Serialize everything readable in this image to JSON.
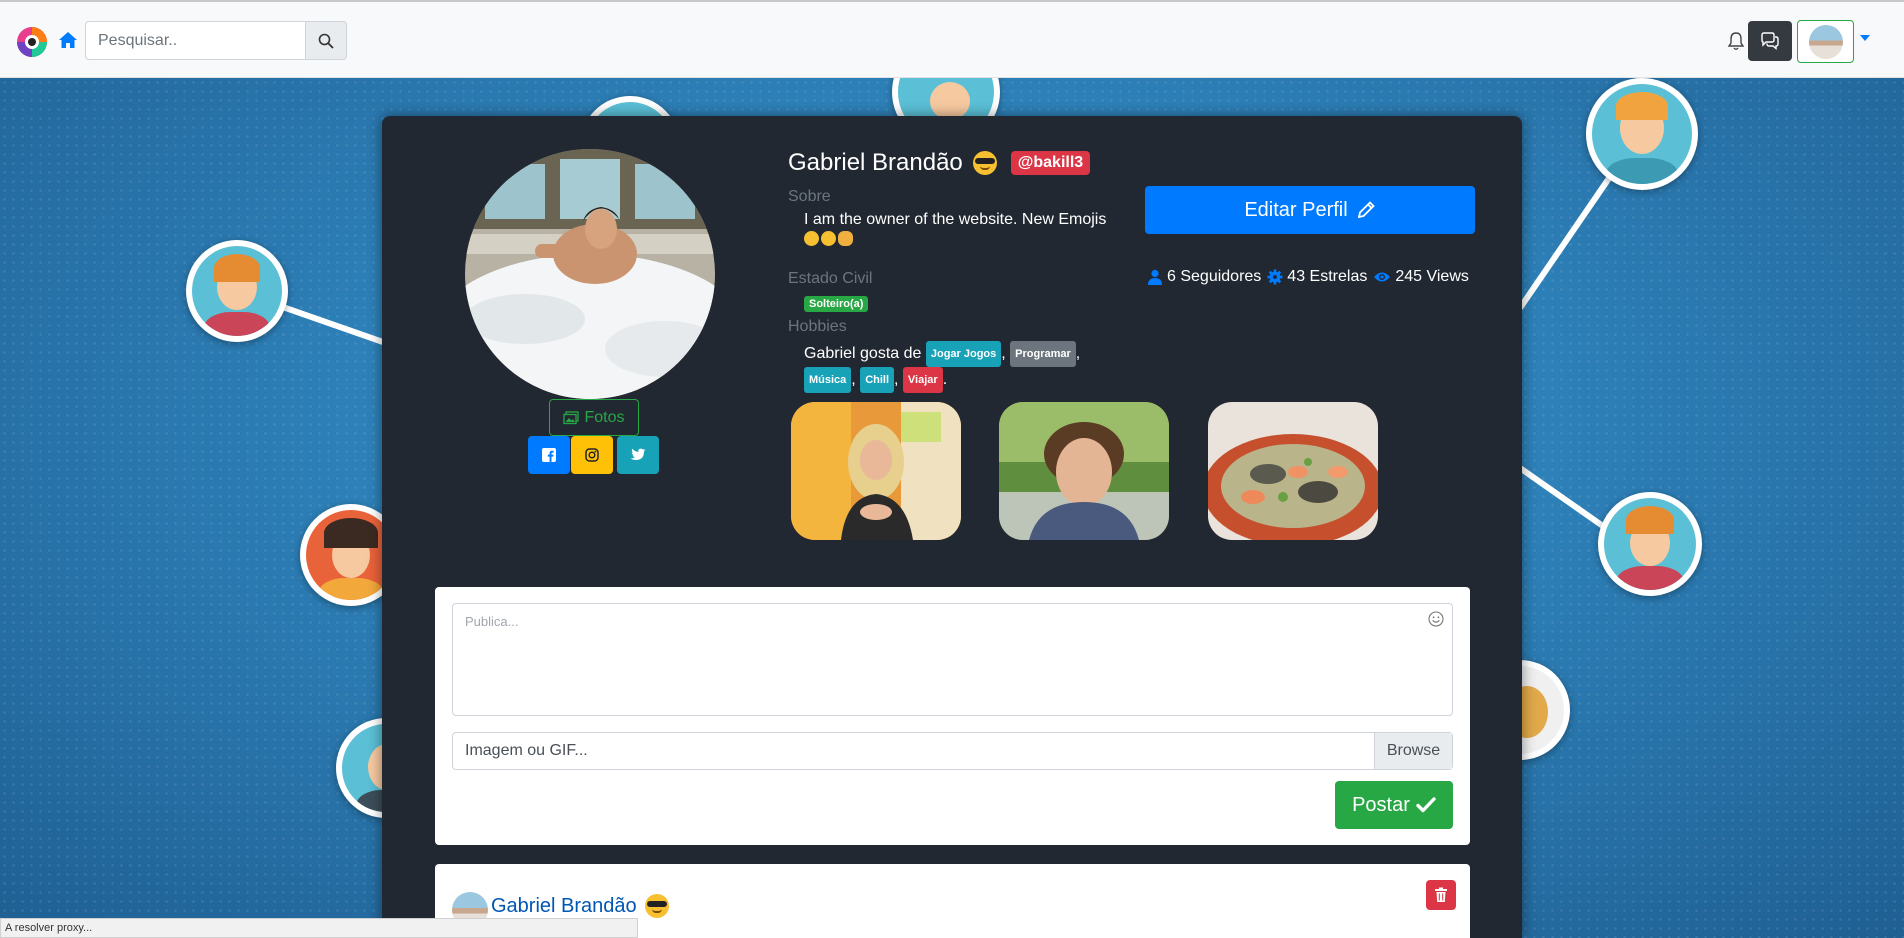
{
  "navbar": {
    "search_placeholder": "Pesquisar.."
  },
  "profile": {
    "name": "Gabriel Brandão",
    "handle": "@bakill3",
    "about_label": "Sobre",
    "about_text": "I am the owner of the website. New Emojis",
    "estado_label": "Estado Civil",
    "estado_value": "Solteiro(a)",
    "hobbies_label": "Hobbies",
    "hobbies_prefix": "Gabriel gosta de",
    "hobbies": [
      "Jogar Jogos",
      "Programar",
      "Música",
      "Chill",
      "Viajar"
    ],
    "fotos_label": "Fotos",
    "edit_label": "Editar Perfil",
    "stats": {
      "followers": "6 Seguidores",
      "stars": "43 Estrelas",
      "views": "245 Views"
    }
  },
  "post_form": {
    "placeholder": "Publica...",
    "file_label": "Imagem ou GIF...",
    "browse_label": "Browse",
    "submit_label": "Postar"
  },
  "feed": {
    "author": "Gabriel Brandão"
  },
  "status_bar": "A resolver proxy...",
  "colors": {
    "primary": "#007bff",
    "success": "#28a745",
    "danger": "#dc3545",
    "warning": "#ffc107",
    "info": "#17a2b8",
    "card_dark": "#212831"
  }
}
